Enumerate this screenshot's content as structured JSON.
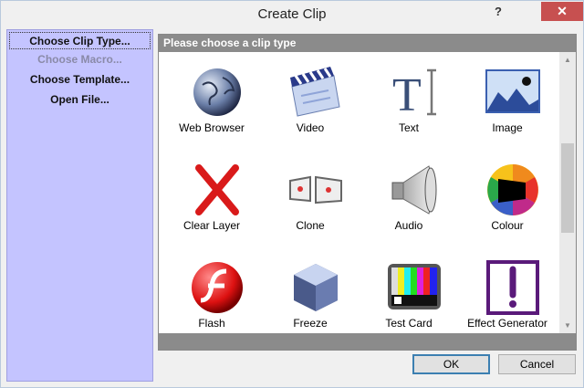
{
  "window": {
    "title": "Create Clip",
    "help_glyph": "?",
    "close_glyph": "✕"
  },
  "sidebar": {
    "items": [
      {
        "label": "Choose Clip Type..."
      },
      {
        "label": "Choose Macro..."
      },
      {
        "label": "Choose Template..."
      },
      {
        "label": "Open File..."
      }
    ]
  },
  "panel": {
    "header": "Please choose a clip type",
    "clips": [
      {
        "label": "Web Browser",
        "icon": "globe-icon"
      },
      {
        "label": "Video",
        "icon": "clapperboard-icon"
      },
      {
        "label": "Text",
        "icon": "text-cursor-icon"
      },
      {
        "label": "Image",
        "icon": "image-icon"
      },
      {
        "label": "Clear Layer",
        "icon": "red-x-icon"
      },
      {
        "label": "Clone",
        "icon": "clone-icon"
      },
      {
        "label": "Audio",
        "icon": "speaker-icon"
      },
      {
        "label": "Colour",
        "icon": "color-wheel-icon"
      },
      {
        "label": "Flash",
        "icon": "flash-icon"
      },
      {
        "label": "Freeze",
        "icon": "ice-cube-icon"
      },
      {
        "label": "Test Card",
        "icon": "test-card-icon"
      },
      {
        "label": "Effect Generator",
        "icon": "exclamation-icon"
      }
    ]
  },
  "buttons": {
    "ok": "OK",
    "cancel": "Cancel"
  }
}
